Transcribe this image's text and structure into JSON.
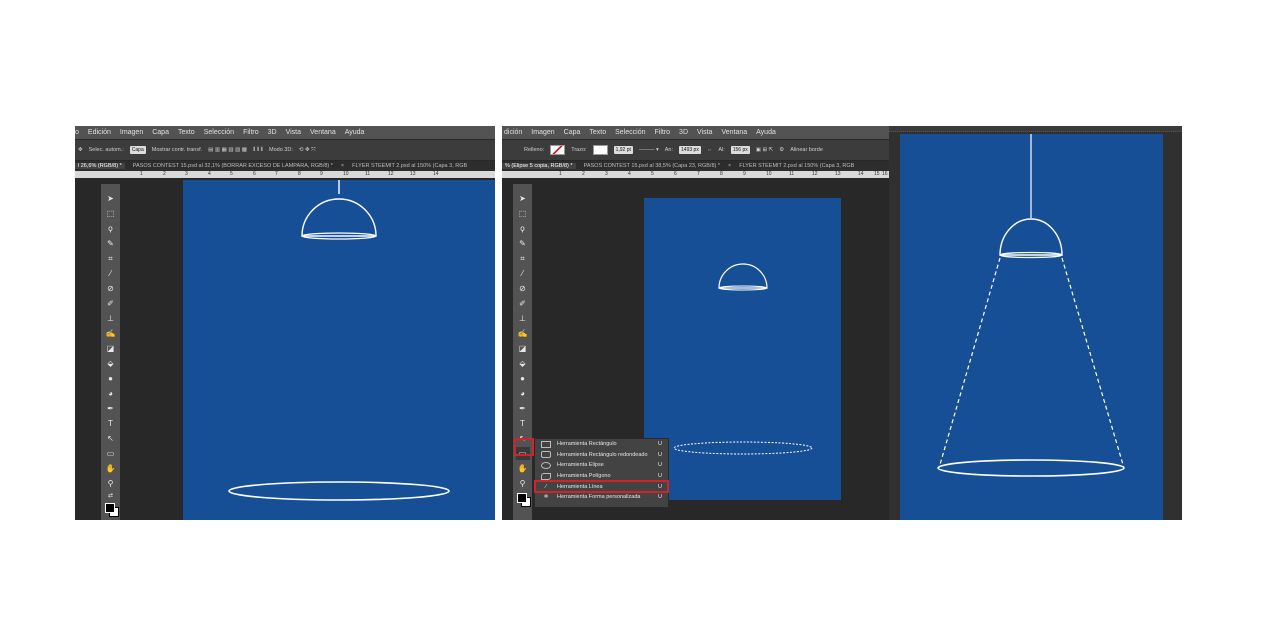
{
  "menu_left": [
    "o",
    "Edición",
    "Imagen",
    "Capa",
    "Texto",
    "Selección",
    "Filtro",
    "3D",
    "Vista",
    "Ventana",
    "Ayuda"
  ],
  "menu_right": [
    "dición",
    "Imagen",
    "Capa",
    "Texto",
    "Selección",
    "Filtro",
    "3D",
    "Vista",
    "Ventana",
    "Ayuda"
  ],
  "options_left": {
    "auto_select": "Selec. autom.:",
    "layer_value": "Capa",
    "show_transform": "Mostrar contr. transf.",
    "mode3d": "Modo 3D:"
  },
  "options_right": {
    "fill_label": "Relleno:",
    "stroke_label": "Trazo:",
    "stroke_width": "1,92 pt",
    "w_label": "An:",
    "w_value": "1493 px",
    "h_label": "Al:",
    "h_value": "156 px",
    "align_edges": "Alinear borde"
  },
  "tabs_left": [
    {
      "label": "l 26,6% (RGB/8) *",
      "active": true
    },
    {
      "label": "PASOS CONTEST 15.psd al 32,1% (BORRAR EXCESO DE LAMPARA, RGB/8) *",
      "active": false
    },
    {
      "label": "FLYER STEEMIT 2.psd al 150% (Capa 3, RGB",
      "active": false
    }
  ],
  "tabs_right": [
    {
      "label": "% (Elipse 5 copia, RGB/8) *",
      "active": true
    },
    {
      "label": "PASOS CONTEST 15.psd al 38,5% (Capa 23, RGB/8) *",
      "active": false
    },
    {
      "label": "FLYER STEEMIT 2.psd al 150% (Capa 3, RGB",
      "active": false
    }
  ],
  "ruler_left": [
    "1",
    "2",
    "3",
    "4",
    "5",
    "6",
    "7",
    "8",
    "9",
    "10",
    "11",
    "12",
    "13",
    "14"
  ],
  "ruler_right": [
    "1",
    "2",
    "3",
    "4",
    "5",
    "6",
    "7",
    "8",
    "9",
    "10",
    "11",
    "12",
    "13",
    "14",
    "15",
    "16"
  ],
  "shape_flyout": [
    {
      "label": "Herramienta Rectángulo",
      "key": "U",
      "highlighted": false
    },
    {
      "label": "Herramienta Rectángulo redondeado",
      "key": "U",
      "highlighted": false
    },
    {
      "label": "Herramienta Elipse",
      "key": "U",
      "highlighted": false
    },
    {
      "label": "Herramienta Polígono",
      "key": "U",
      "highlighted": false
    },
    {
      "label": "Herramienta Línea",
      "key": "U",
      "highlighted": true
    },
    {
      "label": "Herramienta Forma personalizada",
      "key": "U",
      "highlighted": false
    }
  ],
  "colors": {
    "canvas": "#174f96",
    "highlight": "#d3232a",
    "workspace": "#282828"
  }
}
